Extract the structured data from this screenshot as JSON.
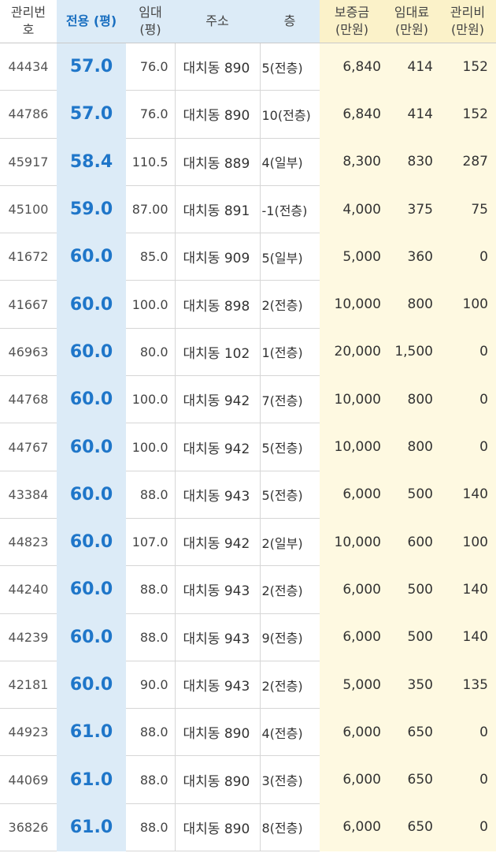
{
  "columns": {
    "id": [
      "관리번",
      "호"
    ],
    "area": "전용 (평)",
    "rent_area": [
      "임대",
      "(평)"
    ],
    "address": "주소",
    "floor": "층",
    "deposit": [
      "보증금",
      "(만원)"
    ],
    "rent": [
      "임대료",
      "(만원)"
    ],
    "fee": [
      "관리비",
      "(만원)"
    ]
  },
  "rows": [
    {
      "id": "44434",
      "area": "57.0",
      "rent_area": "76.0",
      "address": "대치동 890",
      "floor": "5(전층)",
      "deposit": "6,840",
      "rent": "414",
      "fee": "152"
    },
    {
      "id": "44786",
      "area": "57.0",
      "rent_area": "76.0",
      "address": "대치동 890",
      "floor": "10(전층)",
      "deposit": "6,840",
      "rent": "414",
      "fee": "152"
    },
    {
      "id": "45917",
      "area": "58.4",
      "rent_area": "110.5",
      "address": "대치동 889",
      "floor": "4(일부)",
      "deposit": "8,300",
      "rent": "830",
      "fee": "287"
    },
    {
      "id": "45100",
      "area": "59.0",
      "rent_area": "87.00",
      "address": "대치동 891",
      "floor": "-1(전층)",
      "deposit": "4,000",
      "rent": "375",
      "fee": "75"
    },
    {
      "id": "41672",
      "area": "60.0",
      "rent_area": "85.0",
      "address": "대치동 909",
      "floor": "5(일부)",
      "deposit": "5,000",
      "rent": "360",
      "fee": "0"
    },
    {
      "id": "41667",
      "area": "60.0",
      "rent_area": "100.0",
      "address": "대치동 898",
      "floor": "2(전층)",
      "deposit": "10,000",
      "rent": "800",
      "fee": "100"
    },
    {
      "id": "46963",
      "area": "60.0",
      "rent_area": "80.0",
      "address": "대치동 102",
      "floor": "1(전층)",
      "deposit": "20,000",
      "rent": "1,500",
      "fee": "0"
    },
    {
      "id": "44768",
      "area": "60.0",
      "rent_area": "100.0",
      "address": "대치동 942",
      "floor": "7(전층)",
      "deposit": "10,000",
      "rent": "800",
      "fee": "0"
    },
    {
      "id": "44767",
      "area": "60.0",
      "rent_area": "100.0",
      "address": "대치동 942",
      "floor": "5(전층)",
      "deposit": "10,000",
      "rent": "800",
      "fee": "0"
    },
    {
      "id": "43384",
      "area": "60.0",
      "rent_area": "88.0",
      "address": "대치동 943",
      "floor": "5(전층)",
      "deposit": "6,000",
      "rent": "500",
      "fee": "140"
    },
    {
      "id": "44823",
      "area": "60.0",
      "rent_area": "107.0",
      "address": "대치동 942",
      "floor": "2(일부)",
      "deposit": "10,000",
      "rent": "600",
      "fee": "100"
    },
    {
      "id": "44240",
      "area": "60.0",
      "rent_area": "88.0",
      "address": "대치동 943",
      "floor": "2(전층)",
      "deposit": "6,000",
      "rent": "500",
      "fee": "140"
    },
    {
      "id": "44239",
      "area": "60.0",
      "rent_area": "88.0",
      "address": "대치동 943",
      "floor": "9(전층)",
      "deposit": "6,000",
      "rent": "500",
      "fee": "140"
    },
    {
      "id": "42181",
      "area": "60.0",
      "rent_area": "90.0",
      "address": "대치동 943",
      "floor": "2(전층)",
      "deposit": "5,000",
      "rent": "350",
      "fee": "135"
    },
    {
      "id": "44923",
      "area": "61.0",
      "rent_area": "88.0",
      "address": "대치동 890",
      "floor": "4(전층)",
      "deposit": "6,000",
      "rent": "650",
      "fee": "0"
    },
    {
      "id": "44069",
      "area": "61.0",
      "rent_area": "88.0",
      "address": "대치동 890",
      "floor": "3(전층)",
      "deposit": "6,000",
      "rent": "650",
      "fee": "0"
    },
    {
      "id": "36826",
      "area": "61.0",
      "rent_area": "88.0",
      "address": "대치동 890",
      "floor": "8(전층)",
      "deposit": "6,000",
      "rent": "650",
      "fee": "0"
    }
  ],
  "colors": {
    "area_column_bg": "#dcebf7",
    "area_value_text": "#1f76c9",
    "money_columns_bg": "#fef9e1"
  }
}
